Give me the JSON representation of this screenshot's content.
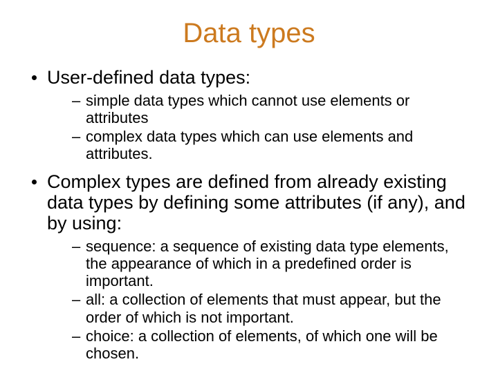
{
  "title": "Data types",
  "bullets": [
    {
      "text": "User-defined data types:",
      "sub": [
        "simple data types which cannot use elements or attributes",
        "complex data types which can use elements and attributes."
      ]
    },
    {
      "text": "Complex types are defined from already existing data types by defining some attributes (if any), and by using:",
      "sub": [
        "sequence: a sequence of existing data type elements, the appearance of which in a predefined order is important.",
        "all: a collection of elements that must appear, but the order of which is not important.",
        "choice: a collection of elements, of which one will be chosen."
      ]
    }
  ]
}
